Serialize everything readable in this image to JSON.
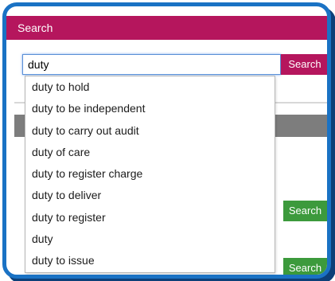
{
  "header": {
    "title": "Search"
  },
  "search": {
    "value": "duty",
    "button_label": "Search"
  },
  "suggestions": [
    "duty to hold",
    "duty to be independent",
    "duty to carry out audit",
    "duty of care",
    "duty to register charge",
    "duty to deliver",
    "duty to register",
    "duty",
    "duty to issue"
  ],
  "lower_buttons": [
    "Search",
    "Search"
  ],
  "colors": {
    "header": "#b5165d",
    "frame": "#1a72c4",
    "green_button": "#3c9a3c"
  }
}
